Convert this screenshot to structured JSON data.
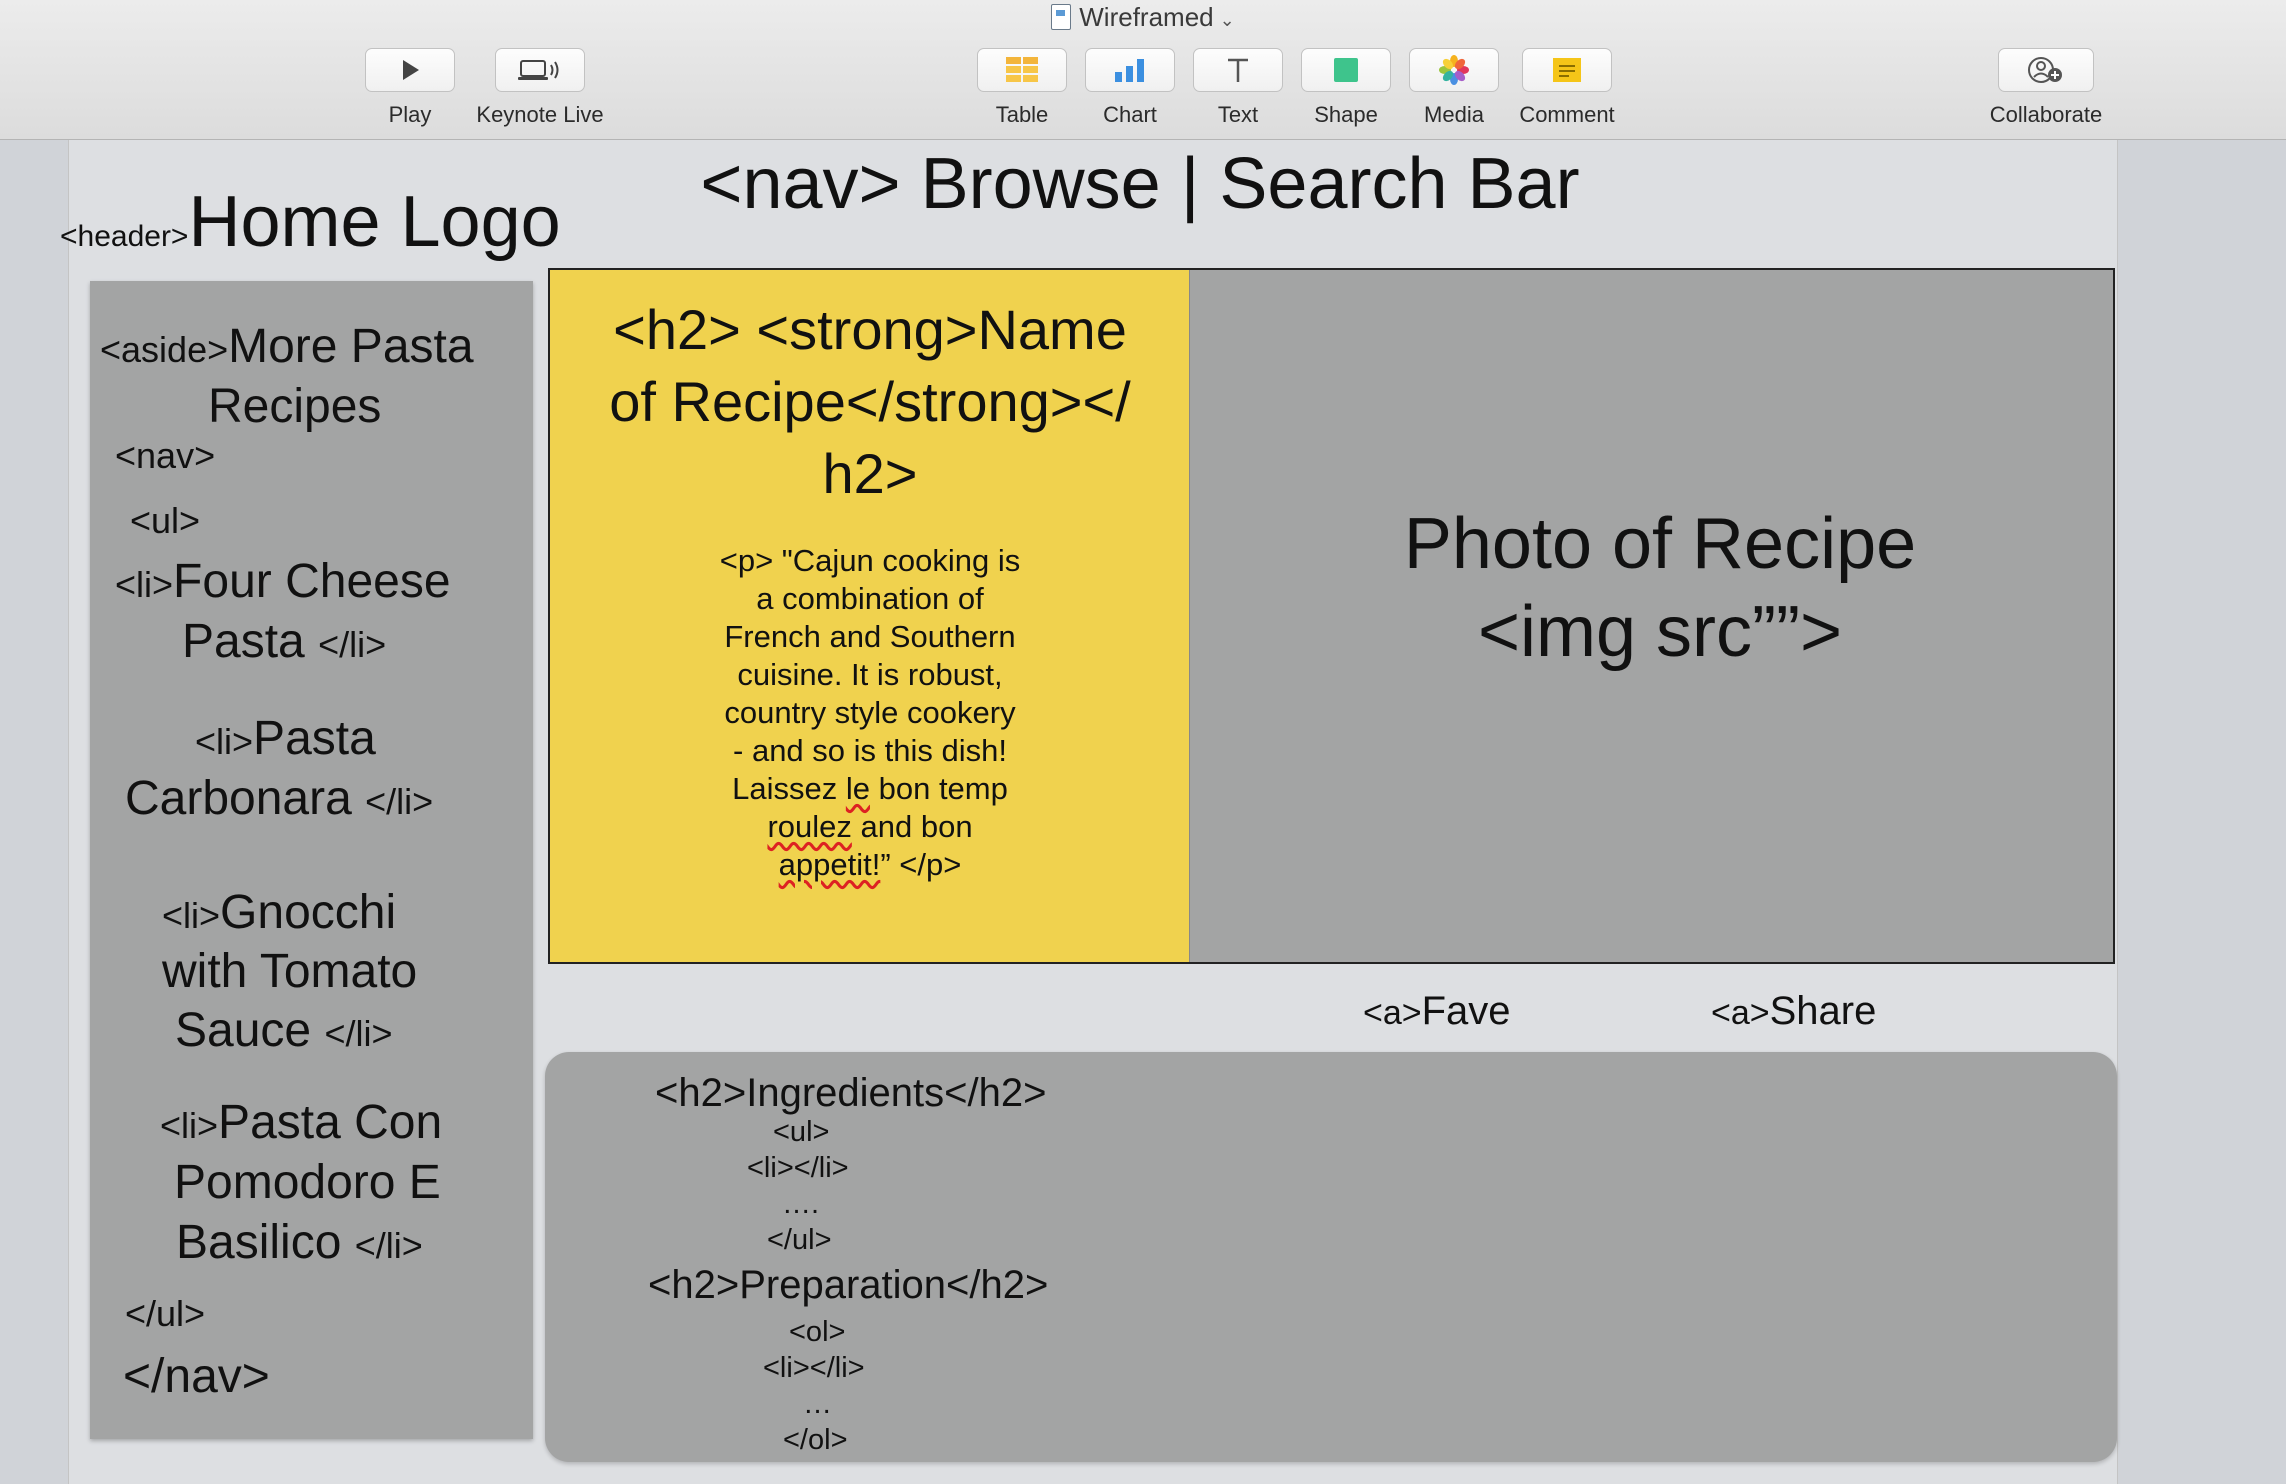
{
  "window": {
    "title": "Wireframed"
  },
  "toolbar": {
    "play": "Play",
    "keynote_live": "Keynote Live",
    "table": "Table",
    "chart": "Chart",
    "text": "Text",
    "shape": "Shape",
    "media": "Media",
    "comment": "Comment",
    "collaborate": "Collaborate"
  },
  "slide": {
    "nav_heading": "<nav> Browse | Search Bar",
    "header_tag": "<header>",
    "home_logo": "Home Logo",
    "aside": {
      "line1_tag": "<aside>",
      "line1_text": "More Pasta",
      "line2": "Recipes",
      "nav_open": "<nav>",
      "ul_open": "<ul>",
      "items": [
        {
          "li": "<li>",
          "line1": "Four Cheese",
          "line2": "Pasta",
          "close": "</li>"
        },
        {
          "li": "<li>",
          "line1": "Pasta",
          "line2": "Carbonara",
          "close": "</li>"
        },
        {
          "li": "<li>",
          "line1": "Gnocchi",
          "line2": "with Tomato",
          "line3": "Sauce",
          "close": "</li>"
        },
        {
          "li": "<li>",
          "line1": "Pasta Con",
          "line2": "Pomodoro E",
          "line3": "Basilico",
          "close": "</li>"
        }
      ],
      "ul_close": "</ul>",
      "nav_close": "</nav>"
    },
    "recipe_card": {
      "title_l1": "<h2> <strong>Name",
      "title_l2": "of Recipe</strong></",
      "title_l3": "h2>",
      "desc_lines": [
        "<p> \"Cajun cooking is",
        "a combination of",
        "French and Southern",
        "cuisine. It is robust,",
        "country style cookery",
        "- and so is this dish!",
        "Laissez",
        "le",
        "bon temp",
        "roulez",
        "and bon",
        "appetit!",
        "” </p>"
      ]
    },
    "photo": {
      "line1": "Photo of Recipe",
      "line2": "<img src””>"
    },
    "links": {
      "fave_tag": "<a>",
      "fave": "Fave",
      "share_tag": "<a>",
      "share": "Share"
    },
    "content": {
      "ingredients_heading": "<h2>Ingredients</h2>",
      "ul_open": "<ul>",
      "ul_li": "<li></li>",
      "ul_dots": "….",
      "ul_close": "</ul>",
      "preparation_heading": "<h2>Preparation</h2>",
      "ol_open": "<ol>",
      "ol_li": "<li></li>",
      "ol_dots": "…",
      "ol_close": "</ol>"
    }
  }
}
